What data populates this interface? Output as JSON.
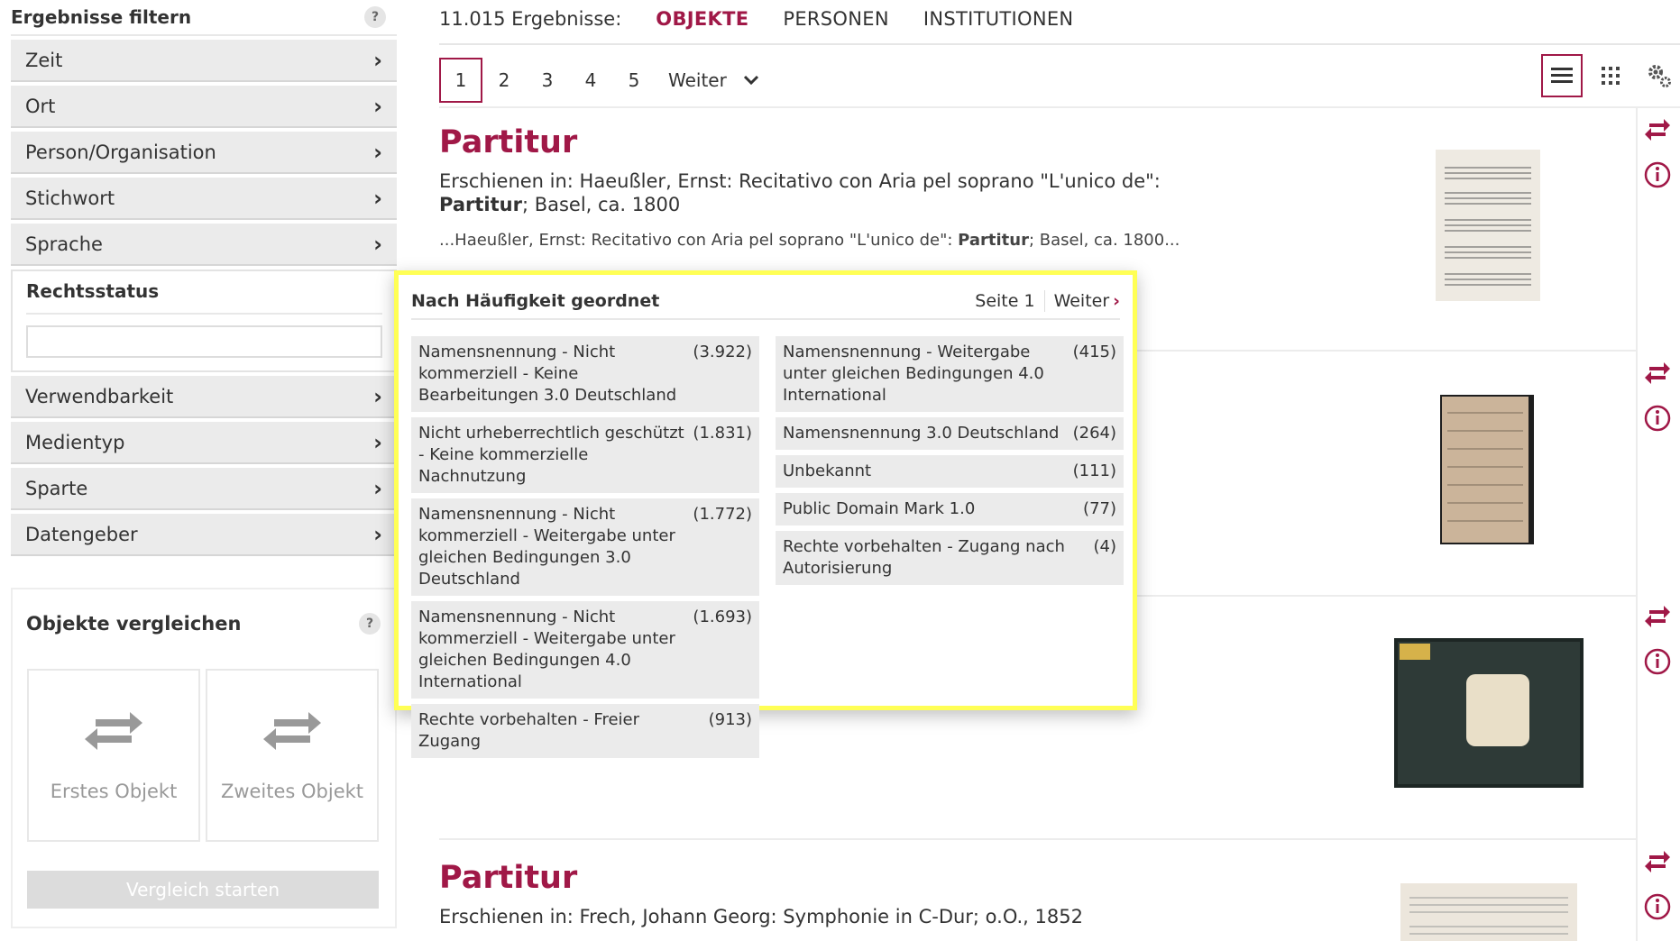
{
  "sidebar": {
    "title": "Ergebnisse filtern",
    "help": "?",
    "facets_top": [
      "Zeit",
      "Ort",
      "Person/Organisation",
      "Stichwort",
      "Sprache"
    ],
    "open_facet": {
      "title": "Rechtsstatus",
      "input_value": ""
    },
    "facets_bottom": [
      "Verwendbarkeit",
      "Medientyp",
      "Sparte",
      "Datengeber"
    ],
    "chevron": "›"
  },
  "compare": {
    "title": "Objekte vergleichen",
    "help": "?",
    "slot1": "Erstes Objekt",
    "slot2": "Zweites Objekt",
    "button": "Vergleich starten"
  },
  "topbar": {
    "count": "11.015 Ergebnisse:",
    "tabs": [
      "OBJEKTE",
      "PERSONEN",
      "INSTITUTIONEN"
    ]
  },
  "pager": {
    "pages": [
      "1",
      "2",
      "3",
      "4",
      "5"
    ],
    "next": "Weiter",
    "dropdown": "⌄"
  },
  "results": [
    {
      "title": "Partitur",
      "line_prefix": "Erschienen in: Haeußler, Ernst: Recitativo con Aria pel soprano \"L'unico de\": ",
      "line_bold": "Partitur",
      "line_suffix": "; Basel, ca. 1800",
      "snippet_prefix": "...Haeußler, Ernst: Recitativo con Aria pel soprano \"L'unico de\": ",
      "snippet_bold": "Partitur",
      "snippet_suffix": "; Basel, ca. 1800..."
    },
    {
      "title": "Partitur",
      "line_prefix": "Erschienen in: Frech, Johann Georg: Symphonie in C-Dur; o.O., 1852"
    }
  ],
  "popover": {
    "heading": "Nach Häufigkeit geordnet",
    "page_label": "Seite 1",
    "next": "Weiter",
    "next_arrow": "›",
    "col1": [
      {
        "label": "Namensnennung - Nicht kommerziell - Keine Bearbeitungen 3.0 Deutschland",
        "count": "(3.922)"
      },
      {
        "label": "Nicht urheberrechtlich geschützt - Keine kommerzielle Nachnutzung",
        "count": "(1.831)"
      },
      {
        "label": "Namensnennung - Nicht kommerziell - Weitergabe unter gleichen Bedingungen 3.0 Deutschland",
        "count": "(1.772)"
      },
      {
        "label": "Namensnennung - Nicht kommerziell - Weitergabe unter gleichen Bedingungen 4.0 International",
        "count": "(1.693)"
      },
      {
        "label": "Rechte vorbehalten - Freier Zugang",
        "count": "(913)"
      }
    ],
    "col2": [
      {
        "label": "Namensnennung - Weitergabe unter gleichen Bedingungen 4.0 International",
        "count": "(415)"
      },
      {
        "label": "Namensnennung 3.0 Deutschland",
        "count": "(264)"
      },
      {
        "label": "Unbekannt",
        "count": "(111)"
      },
      {
        "label": "Public Domain Mark 1.0",
        "count": "(77)"
      },
      {
        "label": "Rechte vorbehalten - Zugang nach Autorisierung",
        "count": "(4)"
      }
    ]
  },
  "colors": {
    "accent": "#a01847",
    "highlight": "#ffff55",
    "facet_bg": "#ebebeb"
  }
}
